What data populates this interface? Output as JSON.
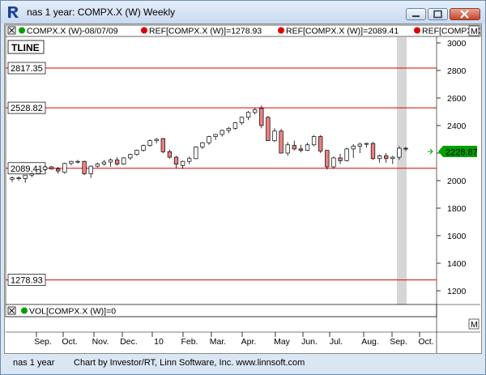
{
  "window": {
    "title": "nas 1 year: COMPX.X (W) Weekly",
    "icon": "investor-rt-logo-icon"
  },
  "chart": {
    "header_symbol": "COMPX.X (W)-08/07/09",
    "header_ref1": "REF[COMPX.X (W)]=1278.93",
    "header_ref2": "REF[COMPX.X (W)]=2089.41",
    "header_ref3": "REF[COMPX.X",
    "header_m": "M",
    "tline_label": "TLINE",
    "current_price_label": "2228.87",
    "current_price_color": "#00a000",
    "volume_label": "VOL[COMPX.X (W)]=0",
    "volume_m": "M",
    "level_line_color": "#e00000",
    "levels": [
      "2817.35",
      "2528.82",
      "2089.41",
      "1278.93"
    ]
  },
  "chart_data": {
    "type": "candlestick",
    "ylim": [
      1100,
      3050
    ],
    "y_ticks": [
      "3000",
      "2800",
      "2600",
      "2400",
      "2200",
      "2000",
      "1800",
      "1600",
      "1400",
      "1200"
    ],
    "x_labels": [
      "Sep.",
      "Oct.",
      "Nov.",
      "Dec.",
      "10",
      "Feb.",
      "Mar.",
      "Apr.",
      "May",
      "Jun.",
      "Jul.",
      "Aug.",
      "Sep.",
      "Oct."
    ],
    "horizontal_levels": [
      2817.35,
      2528.82,
      2089.41,
      1278.93
    ],
    "last_price": 2228.87,
    "candles": [
      {
        "o": 2010,
        "h": 2030,
        "l": 1990,
        "c": 2020
      },
      {
        "o": 2015,
        "h": 2030,
        "l": 2000,
        "c": 2020
      },
      {
        "o": 2015,
        "h": 2040,
        "l": 1985,
        "c": 2040
      },
      {
        "o": 2040,
        "h": 2060,
        "l": 2025,
        "c": 2050
      },
      {
        "o": 2050,
        "h": 2085,
        "l": 2045,
        "c": 2080
      },
      {
        "o": 2080,
        "h": 2110,
        "l": 2070,
        "c": 2100
      },
      {
        "o": 2100,
        "h": 2105,
        "l": 2080,
        "c": 2085
      },
      {
        "o": 2085,
        "h": 2100,
        "l": 2050,
        "c": 2070
      },
      {
        "o": 2060,
        "h": 2130,
        "l": 2050,
        "c": 2125
      },
      {
        "o": 2125,
        "h": 2145,
        "l": 2110,
        "c": 2140
      },
      {
        "o": 2140,
        "h": 2150,
        "l": 2125,
        "c": 2140
      },
      {
        "o": 2140,
        "h": 2145,
        "l": 2040,
        "c": 2050
      },
      {
        "o": 2050,
        "h": 2110,
        "l": 2020,
        "c": 2105
      },
      {
        "o": 2105,
        "h": 2130,
        "l": 2095,
        "c": 2120
      },
      {
        "o": 2120,
        "h": 2150,
        "l": 2110,
        "c": 2135
      },
      {
        "o": 2135,
        "h": 2160,
        "l": 2100,
        "c": 2150
      },
      {
        "o": 2150,
        "h": 2170,
        "l": 2110,
        "c": 2120
      },
      {
        "o": 2120,
        "h": 2170,
        "l": 2115,
        "c": 2165
      },
      {
        "o": 2165,
        "h": 2195,
        "l": 2150,
        "c": 2190
      },
      {
        "o": 2190,
        "h": 2225,
        "l": 2180,
        "c": 2220
      },
      {
        "o": 2220,
        "h": 2260,
        "l": 2210,
        "c": 2255
      },
      {
        "o": 2255,
        "h": 2300,
        "l": 2245,
        "c": 2290
      },
      {
        "o": 2290,
        "h": 2310,
        "l": 2270,
        "c": 2300
      },
      {
        "o": 2305,
        "h": 2310,
        "l": 2200,
        "c": 2210
      },
      {
        "o": 2210,
        "h": 2225,
        "l": 2160,
        "c": 2170
      },
      {
        "o": 2170,
        "h": 2180,
        "l": 2090,
        "c": 2120
      },
      {
        "o": 2110,
        "h": 2145,
        "l": 2085,
        "c": 2140
      },
      {
        "o": 2140,
        "h": 2175,
        "l": 2120,
        "c": 2160
      },
      {
        "o": 2160,
        "h": 2250,
        "l": 2155,
        "c": 2245
      },
      {
        "o": 2245,
        "h": 2280,
        "l": 2230,
        "c": 2275
      },
      {
        "o": 2275,
        "h": 2325,
        "l": 2260,
        "c": 2320
      },
      {
        "o": 2320,
        "h": 2340,
        "l": 2295,
        "c": 2335
      },
      {
        "o": 2335,
        "h": 2370,
        "l": 2320,
        "c": 2365
      },
      {
        "o": 2365,
        "h": 2390,
        "l": 2345,
        "c": 2380
      },
      {
        "o": 2380,
        "h": 2425,
        "l": 2370,
        "c": 2420
      },
      {
        "o": 2420,
        "h": 2465,
        "l": 2405,
        "c": 2460
      },
      {
        "o": 2460,
        "h": 2505,
        "l": 2440,
        "c": 2495
      },
      {
        "o": 2495,
        "h": 2530,
        "l": 2480,
        "c": 2515
      },
      {
        "o": 2525,
        "h": 2545,
        "l": 2380,
        "c": 2400
      },
      {
        "o": 2460,
        "h": 2470,
        "l": 2290,
        "c": 2290
      },
      {
        "o": 2290,
        "h": 2380,
        "l": 2280,
        "c": 2360
      },
      {
        "o": 2360,
        "h": 2375,
        "l": 2200,
        "c": 2200
      },
      {
        "o": 2200,
        "h": 2280,
        "l": 2180,
        "c": 2260
      },
      {
        "o": 2255,
        "h": 2290,
        "l": 2220,
        "c": 2230
      },
      {
        "o": 2230,
        "h": 2260,
        "l": 2205,
        "c": 2220
      },
      {
        "o": 2220,
        "h": 2275,
        "l": 2215,
        "c": 2260
      },
      {
        "o": 2260,
        "h": 2330,
        "l": 2250,
        "c": 2320
      },
      {
        "o": 2320,
        "h": 2330,
        "l": 2200,
        "c": 2215
      },
      {
        "o": 2220,
        "h": 2220,
        "l": 2080,
        "c": 2100
      },
      {
        "o": 2100,
        "h": 2175,
        "l": 2085,
        "c": 2165
      },
      {
        "o": 2165,
        "h": 2195,
        "l": 2120,
        "c": 2145
      },
      {
        "o": 2145,
        "h": 2240,
        "l": 2140,
        "c": 2230
      },
      {
        "o": 2230,
        "h": 2265,
        "l": 2165,
        "c": 2250
      },
      {
        "o": 2250,
        "h": 2275,
        "l": 2200,
        "c": 2265
      },
      {
        "o": 2265,
        "h": 2275,
        "l": 2240,
        "c": 2270
      },
      {
        "o": 2270,
        "h": 2280,
        "l": 2150,
        "c": 2160
      },
      {
        "o": 2160,
        "h": 2190,
        "l": 2130,
        "c": 2180
      },
      {
        "o": 2180,
        "h": 2200,
        "l": 2130,
        "c": 2160
      },
      {
        "o": 2160,
        "h": 2180,
        "l": 2120,
        "c": 2170
      },
      {
        "o": 2170,
        "h": 2250,
        "l": 2150,
        "c": 2235
      },
      {
        "o": 2235,
        "h": 2245,
        "l": 2215,
        "c": 2229
      }
    ]
  },
  "status": {
    "left": "nas 1 year",
    "right": "Chart by Investor/RT, Linn Software, Inc. www.linnsoft.com"
  }
}
